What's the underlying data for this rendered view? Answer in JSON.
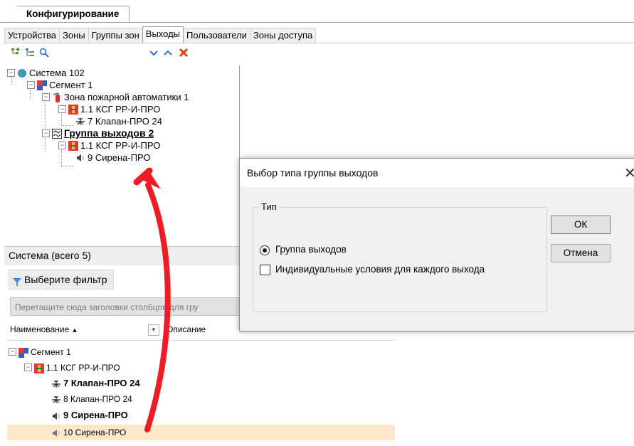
{
  "main_tab": {
    "label": "Конфигурирование"
  },
  "subtabs": [
    "Устройства",
    "Зоны",
    "Группы зон",
    "Выходы",
    "Пользователи",
    "Зоны доступа"
  ],
  "active_subtab": "Выходы",
  "toolbar": {
    "icons": [
      "add-node-icon",
      "tree-view-icon",
      "search-icon",
      "move-down-icon",
      "move-up-icon",
      "delete-icon"
    ]
  },
  "tree": [
    {
      "label": "Система 102",
      "icon": "globe-icon",
      "expander": "−"
    },
    {
      "label": "Сегмент 1",
      "icon": "segment-icon",
      "expander": "−"
    },
    {
      "label": "Зона пожарной автоматики 1",
      "icon": "fire-extinguisher-icon",
      "expander": "−"
    },
    {
      "label": "1.1 КСГ РР-И-ПРО",
      "icon": "device-icon",
      "expander": "−"
    },
    {
      "label": "7 Клапан-ПРО 24",
      "icon": "valve-icon"
    },
    {
      "label": "Группа выходов 2",
      "icon": "output-group-icon",
      "expander": "−"
    },
    {
      "label": "1.1 КСГ РР-И-ПРО",
      "icon": "device-icon",
      "expander": "−"
    },
    {
      "label": "9 Сирена-ПРО",
      "icon": "speaker-icon"
    }
  ],
  "system_panel": {
    "title": "Система (всего 5)",
    "filter_label": "Выберите фильтр",
    "groupby_text": "Перетащите сюда заголовки столбцов для гру",
    "col_name": "Наименование",
    "col_desc": "Описание"
  },
  "grid_rows": [
    {
      "label": "Сегмент 1",
      "icon": "segment-icon",
      "expander": "−"
    },
    {
      "label": "1.1 КСГ РР-И-ПРО",
      "icon": "device-icon",
      "expander": "−"
    },
    {
      "label": "7 Клапан-ПРО 24",
      "icon": "valve-icon"
    },
    {
      "label": "8 Клапан-ПРО 24",
      "icon": "valve-icon"
    },
    {
      "label": "9 Сирена-ПРО",
      "icon": "speaker-icon"
    },
    {
      "label": "10 Сирена-ПРО",
      "icon": "speaker-icon"
    }
  ],
  "dialog": {
    "title": "Выбор типа группы выходов",
    "group_label": "Тип",
    "option_group": "Группа выходов",
    "option_individual": "Индивидуальные условия для каждого выхода",
    "ok_label": "ОК",
    "cancel_label": "Отмена",
    "selected_option": "Группа выходов",
    "individual_checked": false
  },
  "colors": {
    "selection": "#fde8cc",
    "arrow": "#ee1c24",
    "accent_blue": "#2a6fd6"
  }
}
